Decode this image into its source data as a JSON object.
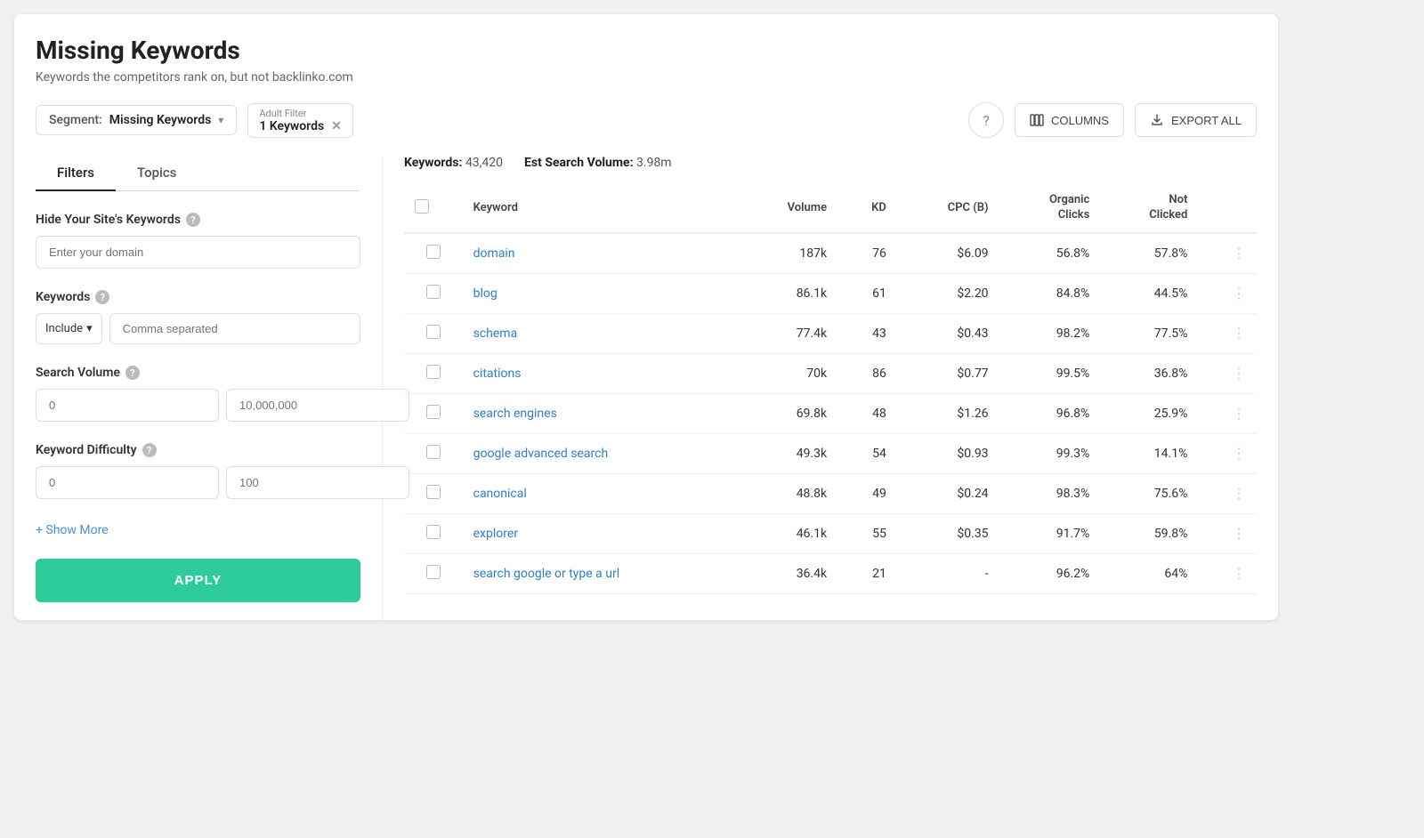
{
  "page": {
    "title": "Missing Keywords",
    "subtitle": "Keywords the competitors rank on, but not backlinko.com"
  },
  "toolbar": {
    "segment_label": "Segment:",
    "segment_value": "Missing Keywords",
    "filter_chip_label": "Adult Filter",
    "filter_chip_value": "1 Keywords",
    "help_icon": "?",
    "columns_label": "COLUMNS",
    "export_label": "EXPORT ALL"
  },
  "sidebar": {
    "tab_filters": "Filters",
    "tab_topics": "Topics",
    "hide_keywords_title": "Hide Your Site's Keywords",
    "domain_placeholder": "Enter your domain",
    "keywords_title": "Keywords",
    "include_label": "Include",
    "comma_placeholder": "Comma separated",
    "search_volume_title": "Search Volume",
    "volume_min_placeholder": "0",
    "volume_max_placeholder": "10,000,000",
    "keyword_difficulty_title": "Keyword Difficulty",
    "kd_min_placeholder": "0",
    "kd_max_placeholder": "100",
    "show_more": "+ Show More",
    "apply_btn": "APPLY"
  },
  "stats": {
    "keywords_label": "Keywords:",
    "keywords_value": "43,420",
    "volume_label": "Est Search Volume:",
    "volume_value": "3.98m"
  },
  "table": {
    "columns": [
      "",
      "Keyword",
      "Volume",
      "KD",
      "CPC (B)",
      "Organic\nClicks",
      "Not\nClicked",
      ""
    ],
    "rows": [
      {
        "keyword": "domain",
        "volume": "187k",
        "kd": "76",
        "cpc": "$6.09",
        "organic": "56.8%",
        "not_clicked": "57.8%"
      },
      {
        "keyword": "blog",
        "volume": "86.1k",
        "kd": "61",
        "cpc": "$2.20",
        "organic": "84.8%",
        "not_clicked": "44.5%"
      },
      {
        "keyword": "schema",
        "volume": "77.4k",
        "kd": "43",
        "cpc": "$0.43",
        "organic": "98.2%",
        "not_clicked": "77.5%"
      },
      {
        "keyword": "citations",
        "volume": "70k",
        "kd": "86",
        "cpc": "$0.77",
        "organic": "99.5%",
        "not_clicked": "36.8%"
      },
      {
        "keyword": "search engines",
        "volume": "69.8k",
        "kd": "48",
        "cpc": "$1.26",
        "organic": "96.8%",
        "not_clicked": "25.9%"
      },
      {
        "keyword": "google advanced search",
        "volume": "49.3k",
        "kd": "54",
        "cpc": "$0.93",
        "organic": "99.3%",
        "not_clicked": "14.1%"
      },
      {
        "keyword": "canonical",
        "volume": "48.8k",
        "kd": "49",
        "cpc": "$0.24",
        "organic": "98.3%",
        "not_clicked": "75.6%"
      },
      {
        "keyword": "explorer",
        "volume": "46.1k",
        "kd": "55",
        "cpc": "$0.35",
        "organic": "91.7%",
        "not_clicked": "59.8%"
      },
      {
        "keyword": "search google or type a url",
        "volume": "36.4k",
        "kd": "21",
        "cpc": "-",
        "organic": "96.2%",
        "not_clicked": "64%"
      }
    ]
  }
}
